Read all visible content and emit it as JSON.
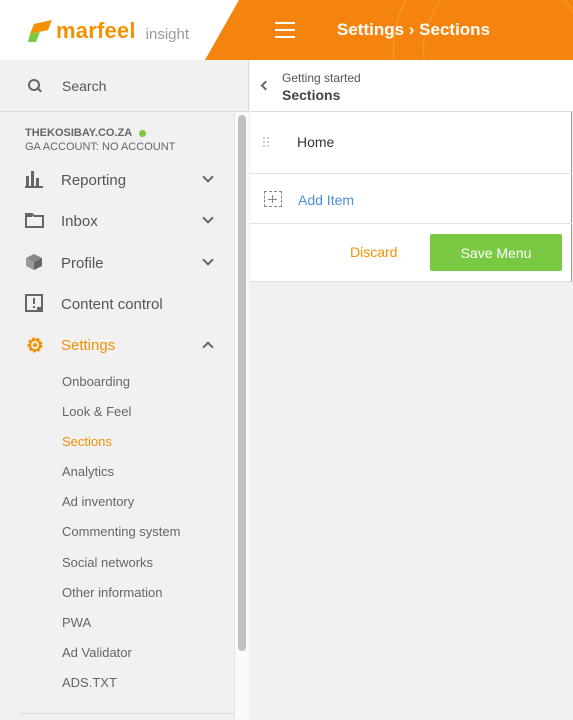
{
  "header": {
    "logo_word": "marfeel",
    "logo_sub": "insight",
    "title": "Settings › Sections"
  },
  "sidebar": {
    "search_placeholder": "Search",
    "account_name": "THEKOSIBAY.CO.ZA",
    "account_status_color": "#7ac943",
    "ga_account": "GA ACCOUNT: NO ACCOUNT",
    "nav": [
      {
        "label": "Reporting",
        "icon": "bar-chart-icon",
        "expandable": true
      },
      {
        "label": "Inbox",
        "icon": "folder-icon",
        "expandable": true
      },
      {
        "label": "Profile",
        "icon": "cube-icon",
        "expandable": true
      },
      {
        "label": "Content control",
        "icon": "content-control-icon",
        "expandable": false
      },
      {
        "label": "Settings",
        "icon": "gear-icon",
        "expandable": true,
        "active": true
      }
    ],
    "settings_items": [
      "Onboarding",
      "Look & Feel",
      "Sections",
      "Analytics",
      "Ad inventory",
      "Commenting system",
      "Social networks",
      "Other information",
      "PWA",
      "Ad Validator",
      "ADS.TXT"
    ],
    "active_settings_item": "Sections"
  },
  "main": {
    "breadcrumb_parent": "Getting started",
    "breadcrumb_current": "Sections",
    "menu_items": [
      "Home"
    ],
    "add_item_label": "Add Item",
    "discard_label": "Discard",
    "save_label": "Save Menu"
  },
  "colors": {
    "brand_orange": "#f39200",
    "save_green": "#7ac943",
    "link_blue": "#4a90d9"
  }
}
